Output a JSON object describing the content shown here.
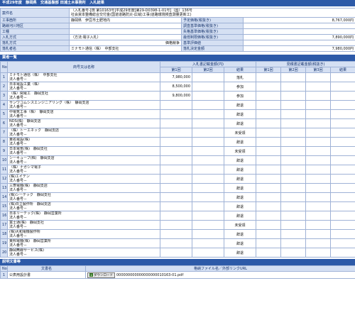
{
  "title": "平成29年度　静岡県　交通基盤部 田浦土木事務所　入札結果",
  "info": {
    "rows": [
      {
        "left_label": "案件名",
        "left_value": [
          "（入札番号-[田 第10163号]平成29年度[第29-D0398-1-01号]（国）136号",
          "社会資本整備総合交付金(国道道路防災-広域)工事(道路環境検査測量更新工)"
        ],
        "right_label": "",
        "right_value": ""
      },
      {
        "left_label": "工事箇所",
        "left_value": [
          "静岡県　伊豆市土肥地内"
        ],
        "right_label": "予定価格(税抜き)",
        "right_value": "8,767,000円"
      },
      {
        "left_label": "路線河川地区",
        "left_value": [
          ""
        ],
        "right_label": "調査基準価格(税抜き)",
        "right_value": ""
      },
      {
        "left_label": "工種",
        "left_value": [
          ""
        ],
        "right_label": "失格基準価格(税抜き)",
        "right_value": ""
      },
      {
        "left_label": "入札方式",
        "left_value": [
          "（方法:電子入札）"
        ],
        "right_label": "最低制限価格(税抜き)",
        "right_value": "7,890,000円"
      },
      {
        "left_label": "落札方式",
        "left_value": [
          "価格競争"
        ],
        "right_label": "基準評価値",
        "right_value": ""
      },
      {
        "left_label": "落札者名",
        "left_value": [
          "ミナモト通信（株）　中部支社"
        ],
        "right_label": "落札決定金額",
        "right_value": "7,980,000円"
      }
    ]
  },
  "bidders_title": "業者一覧",
  "bidders_header": {
    "no": "No",
    "name": "商号又は名称",
    "bid_group": "入札書記載金額(円)",
    "round1": "第1回",
    "round2": "第2回",
    "result": "結果",
    "negot_group": "見積書記載金額(税抜き)",
    "n1": "第1回",
    "n2": "第2回",
    "n3": "第3回",
    "n_result": "結果"
  },
  "bidders": [
    {
      "no": "1",
      "name": "ミナモト通信（株）　中部支社",
      "sub": "法人番号－",
      "r1": "7,980,000",
      "r2": "",
      "result": "落札"
    },
    {
      "no": "2",
      "name": "日本電設工業（株）",
      "sub": "法人番号－",
      "r1": "8,500,000",
      "r2": "",
      "result": "参加"
    },
    {
      "no": "3",
      "name": "（株）閏電工　静岡支社",
      "sub": "法人番号－",
      "r1": "9,800,000",
      "r2": "",
      "result": "参加"
    },
    {
      "no": "4",
      "name": "サンワコムシスエンジニアリング（株）　静岡支店",
      "sub": "法人番号－",
      "r1": "",
      "r2": "",
      "result": "辞退"
    },
    {
      "no": "5",
      "name": "中電気工事（株）　静岡支店",
      "sub": "法人番号－",
      "r1": "",
      "r2": "",
      "result": "辞退"
    },
    {
      "no": "6",
      "name": "NDS(株)　静岡支店",
      "sub": "法人番号－",
      "r1": "",
      "r2": "",
      "result": "辞退"
    },
    {
      "no": "7",
      "name": "（株）トーエネック　静岡支店",
      "sub": "法人番号－",
      "r1": "",
      "r2": "",
      "result": "未受領"
    },
    {
      "no": "8",
      "name": "東名電設(株)",
      "sub": "法人番号－",
      "r1": "",
      "r2": "",
      "result": "辞退"
    },
    {
      "no": "9",
      "name": "日本電気(株)　静岡支社",
      "sub": "法人番号－",
      "r1": "",
      "r2": "",
      "result": "未受領"
    },
    {
      "no": "10",
      "name": "シーキューブ(株)　静岡支店",
      "sub": "法人番号－",
      "r1": "",
      "r2": "",
      "result": "辞退"
    },
    {
      "no": "11",
      "name": "（株）ナガシマ電子",
      "sub": "法人番号－",
      "r1": "",
      "r2": "",
      "result": "辞退"
    },
    {
      "no": "12",
      "name": "(株)エイデン",
      "sub": "法人番号－",
      "r1": "",
      "r2": "",
      "result": "辞退"
    },
    {
      "no": "13",
      "name": "三菱電機(株)　静岡支店",
      "sub": "法人番号－",
      "r1": "",
      "r2": "",
      "result": "辞退"
    },
    {
      "no": "14",
      "name": "(株)シーテック　静岡支社",
      "sub": "法人番号－",
      "r1": "",
      "r2": "",
      "result": "辞退"
    },
    {
      "no": "15",
      "name": "(株)日立製作所　静岡支店",
      "sub": "法人番号－",
      "r1": "",
      "r2": "",
      "result": "辞退"
    },
    {
      "no": "16",
      "name": "日本リーテック(株)　静岡営業所",
      "sub": "法人番号－",
      "r1": "",
      "r2": "",
      "result": "辞退"
    },
    {
      "no": "17",
      "name": "富士通(株)　静岡支社",
      "sub": "法人番号－",
      "r1": "",
      "r2": "",
      "result": "未受領"
    },
    {
      "no": "18",
      "name": "(株)大和電機製作所",
      "sub": "法人番号－",
      "r1": "",
      "r2": "",
      "result": "辞退"
    },
    {
      "no": "19",
      "name": "東邦電機(株)　静岡営業所",
      "sub": "法人番号－",
      "r1": "",
      "r2": "",
      "result": "辞退"
    },
    {
      "no": "20",
      "name": "静岡無線サービス(株)",
      "sub": "法人番号－",
      "r1": "",
      "r2": "",
      "result": "辞退"
    }
  ],
  "docs_title": "説明文書等",
  "docs_header": {
    "no": "No",
    "name": "文書名",
    "file": "格納ファイル名／外部リンクURL"
  },
  "docs": [
    {
      "no": "1",
      "name": "公表用設計書",
      "button": "ダウンロード",
      "file": "000000000000000000010163-01.pdf"
    }
  ]
}
